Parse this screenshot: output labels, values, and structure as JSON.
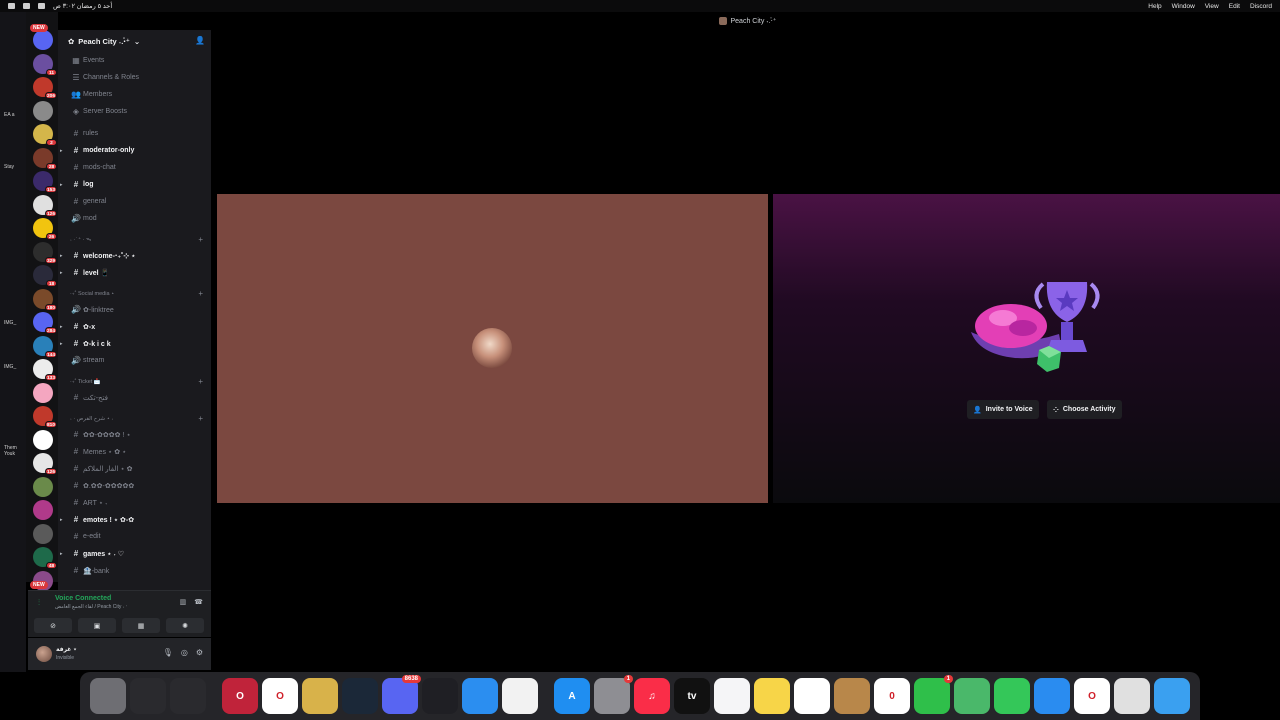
{
  "menubar": {
    "left_text": "أحد ٥ رمضان ٣:٠٢ ص",
    "menus": [
      "Help",
      "Window",
      "View",
      "Edit",
      "Discord"
    ]
  },
  "window": {
    "title": "Peach City ˖.‧̍⁺"
  },
  "desktop_labels": [
    "EA a",
    "Stay",
    "IMG_",
    "IMG_",
    "Them Youk"
  ],
  "guilds": [
    {
      "badge": "NEW",
      "color": "#5865f2"
    },
    {
      "badge": "11",
      "color": "#6b4fa0"
    },
    {
      "badge": "206",
      "color": "#c0392b"
    },
    {
      "badge": "",
      "color": "#8a8a8a"
    },
    {
      "badge": "2",
      "color": "#d4b64a"
    },
    {
      "badge": "28",
      "color": "#7a3a2a"
    },
    {
      "badge": "153",
      "color": "#3b2a6a"
    },
    {
      "badge": "126",
      "color": "#e0e0e0"
    },
    {
      "badge": "26",
      "color": "#f1c40f"
    },
    {
      "badge": "329",
      "color": "#2d2d2d"
    },
    {
      "badge": "18",
      "color": "#2a2a3a"
    },
    {
      "badge": "180",
      "color": "#7a4a2a"
    },
    {
      "badge": "284",
      "color": "#5865f2"
    },
    {
      "badge": "144",
      "color": "#2980b9"
    },
    {
      "badge": "133",
      "color": "#ececec"
    },
    {
      "badge": "",
      "color": "#f4a6c0"
    },
    {
      "badge": "810",
      "color": "#c0392b"
    },
    {
      "badge": "",
      "color": "#ffffff"
    },
    {
      "badge": "126",
      "color": "#e6e6e6"
    },
    {
      "badge": "",
      "color": "#6a8a4a"
    },
    {
      "badge": "",
      "color": "#b03a8a"
    },
    {
      "badge": "",
      "color": "#5a5a5a"
    },
    {
      "badge": "48",
      "color": "#1e6a4a"
    },
    {
      "badge": "NEW",
      "color": "#8a4a8a"
    }
  ],
  "server": {
    "name": "Peach City ˖.‧̍⁺"
  },
  "sidebar_items": [
    {
      "icon": "▦",
      "label": "Events",
      "unread": false
    },
    {
      "icon": "☰",
      "label": "Channels & Roles",
      "unread": false
    },
    {
      "icon": "👥",
      "label": "Members",
      "unread": false
    },
    {
      "icon": "◈",
      "label": "Server Boosts",
      "unread": false
    }
  ],
  "channels_top": [
    {
      "icon": "#",
      "label": "rules",
      "unread": false,
      "caret": false
    },
    {
      "icon": "#",
      "label": "moderator-only",
      "unread": true,
      "caret": true
    },
    {
      "icon": "#",
      "label": "mods-chat",
      "unread": false,
      "caret": false
    },
    {
      "icon": "#",
      "label": "log",
      "unread": true,
      "caret": true
    },
    {
      "icon": "#",
      "label": "general",
      "unread": false,
      "caret": false
    },
    {
      "icon": "🔊",
      "label": "mod",
      "unread": false,
      "caret": false
    }
  ],
  "cat1": {
    "label": "˖ ‧ ̍ ⁺ ‧ ᯓ"
  },
  "channels_cat1": [
    {
      "icon": "#",
      "label": "welcome-‧₊˚⊹ ⋆",
      "unread": true,
      "caret": true
    },
    {
      "icon": "#",
      "label": "level 📱",
      "unread": true,
      "caret": true
    }
  ],
  "cat2": {
    "label": "‧₊˚ Social media ⋆"
  },
  "channels_cat2": [
    {
      "icon": "🔊",
      "label": "✿-linktree",
      "unread": false,
      "caret": false
    },
    {
      "icon": "#",
      "label": "✿-x",
      "unread": true,
      "caret": true
    },
    {
      "icon": "#",
      "label": "✿-k i c k",
      "unread": true,
      "caret": true
    },
    {
      "icon": "🔊",
      "label": "stream",
      "unread": false,
      "caret": false
    }
  ],
  "cat3": {
    "label": "‧₊˚ Ticket 📩"
  },
  "channels_cat3": [
    {
      "icon": "#",
      "label": "فتح-تكت",
      "unread": false,
      "caret": false
    }
  ],
  "cat4": {
    "label": "˖ ‧ شرح الفرص ⋆ ˖"
  },
  "channels_cat4": [
    {
      "icon": "#",
      "label": "✿✿-✿✿✿✿ ! ⋆",
      "unread": false,
      "caret": false
    },
    {
      "icon": "#",
      "label": "Memes ⋆ ✿ ⋆",
      "unread": false,
      "caret": false
    },
    {
      "icon": "#",
      "label": "الفار الملاكم ⋆ ✿",
      "unread": false,
      "caret": false
    },
    {
      "icon": "#",
      "label": "✿.✿✿-✿✿✿✿✿",
      "unread": false,
      "caret": false
    },
    {
      "icon": "#",
      "label": "ART ⋆ ˖",
      "unread": false,
      "caret": false
    },
    {
      "icon": "#",
      "label": "emotes ! ⋆ ✿-✿",
      "unread": true,
      "caret": true
    },
    {
      "icon": "#",
      "label": "e-edit",
      "unread": false,
      "caret": false
    },
    {
      "icon": "#",
      "label": "games ⋆ ˖ ♡",
      "unread": true,
      "caret": true
    },
    {
      "icon": "#",
      "label": "🏦-bank",
      "unread": false,
      "caret": false
    }
  ],
  "voice": {
    "status": "Voice Connected",
    "channel": "لقاء الجمع الغامض / Peach City ˖ ‧",
    "buttons": [
      "camera-off",
      "screen-share",
      "activities",
      "soundboard"
    ]
  },
  "user": {
    "name": "غرفة ⋆",
    "status": "Invisible"
  },
  "activity": {
    "invite_label": "Invite to Voice",
    "choose_label": "Choose Activity"
  },
  "dock": {
    "apps": [
      {
        "name": "trash",
        "label": "",
        "color": "#6e6e73",
        "badge": ""
      },
      {
        "name": "window-1",
        "label": "",
        "color": "#2a2a2e",
        "badge": ""
      },
      {
        "name": "window-2",
        "label": "",
        "color": "#2a2a2e",
        "badge": ""
      },
      {
        "name": "opera-gx",
        "label": "O",
        "color": "#c0233a",
        "badge": ""
      },
      {
        "name": "opera",
        "label": "O",
        "color": "#ffffff",
        "badge": ""
      },
      {
        "name": "game-app",
        "label": "",
        "color": "#d8b24a",
        "badge": ""
      },
      {
        "name": "steam",
        "label": "",
        "color": "#1b2838",
        "badge": ""
      },
      {
        "name": "discord",
        "label": "",
        "color": "#5865f2",
        "badge": "8638"
      },
      {
        "name": "obs",
        "label": "",
        "color": "#1f1f24",
        "badge": ""
      },
      {
        "name": "safari",
        "label": "",
        "color": "#2b8ef0",
        "badge": ""
      },
      {
        "name": "photos-grid",
        "label": "",
        "color": "#f2f2f2",
        "badge": ""
      },
      {
        "name": "app-store",
        "label": "A",
        "color": "#1f8ef1",
        "badge": ""
      },
      {
        "name": "system-settings",
        "label": "",
        "color": "#8e8e93",
        "badge": "1"
      },
      {
        "name": "music",
        "label": "♫",
        "color": "#fa2d48",
        "badge": ""
      },
      {
        "name": "apple-tv",
        "label": "tv",
        "color": "#111111",
        "badge": ""
      },
      {
        "name": "freeform",
        "label": "",
        "color": "#f5f5f7",
        "badge": ""
      },
      {
        "name": "notes",
        "label": "",
        "color": "#f7d548",
        "badge": ""
      },
      {
        "name": "reminders",
        "label": "",
        "color": "#ffffff",
        "badge": ""
      },
      {
        "name": "contacts",
        "label": "",
        "color": "#b8874a",
        "badge": ""
      },
      {
        "name": "calendar",
        "label": "0",
        "color": "#ffffff",
        "badge": ""
      },
      {
        "name": "facetime",
        "label": "",
        "color": "#2fbf4a",
        "badge": "1"
      },
      {
        "name": "maps",
        "label": "",
        "color": "#4ab86a",
        "badge": ""
      },
      {
        "name": "messages",
        "label": "",
        "color": "#34c759",
        "badge": ""
      },
      {
        "name": "mail",
        "label": "",
        "color": "#2a8cf0",
        "badge": ""
      },
      {
        "name": "opera-2",
        "label": "O",
        "color": "#ffffff",
        "badge": ""
      },
      {
        "name": "launchpad",
        "label": "",
        "color": "#e0e0e0",
        "badge": ""
      },
      {
        "name": "finder",
        "label": "",
        "color": "#3aa0f0",
        "badge": ""
      }
    ]
  }
}
